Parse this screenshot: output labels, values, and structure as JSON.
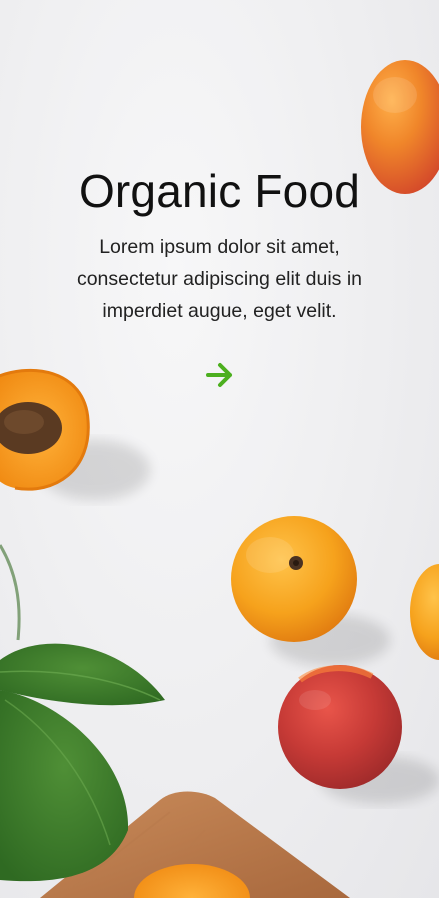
{
  "hero": {
    "title": "Organic Food",
    "description": "Lorem ipsum dolor sit amet, consectetur adipiscing elit duis in imperdiet augue, eget velit."
  },
  "next_button": {
    "icon": "arrow-right-icon",
    "color": "#4caf1f"
  },
  "background": {
    "color": "#efeff1",
    "subject": "apricots-leaves-cutting-board-photo"
  }
}
